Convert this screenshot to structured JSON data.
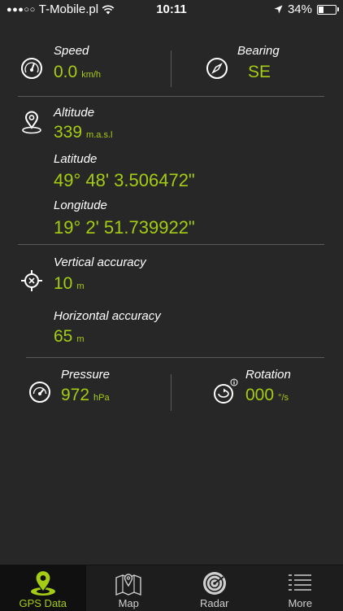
{
  "status_bar": {
    "carrier": "T-Mobile.pl",
    "time": "10:11",
    "battery": "34%",
    "battery_level": 0.34
  },
  "speed": {
    "label": "Speed",
    "value": "0.0",
    "unit": "km/h"
  },
  "bearing": {
    "label": "Bearing",
    "value": "SE"
  },
  "altitude": {
    "label": "Altitude",
    "value": "339",
    "unit": "m.a.s.l"
  },
  "latitude": {
    "label": "Latitude",
    "value": "49° 48' 3.506472\""
  },
  "longitude": {
    "label": "Longitude",
    "value": "19° 2' 51.739922\""
  },
  "vertical_accuracy": {
    "label": "Vertical accuracy",
    "value": "10",
    "unit": "m"
  },
  "horizontal_accuracy": {
    "label": "Horizontal accuracy",
    "value": "65",
    "unit": "m"
  },
  "pressure": {
    "label": "Pressure",
    "value": "972",
    "unit": "hPa"
  },
  "rotation": {
    "label": "Rotation",
    "value": "000",
    "unit": "°/s"
  },
  "tabs": [
    {
      "label": "GPS Data",
      "icon": "location-pin-icon",
      "active": true
    },
    {
      "label": "Map",
      "icon": "map-icon",
      "active": false
    },
    {
      "label": "Radar",
      "icon": "radar-icon",
      "active": false
    },
    {
      "label": "More",
      "icon": "menu-list-icon",
      "active": false
    }
  ],
  "colors": {
    "accent": "#a5cc14",
    "background": "#272727",
    "tabbar": "#1d1d1d"
  }
}
